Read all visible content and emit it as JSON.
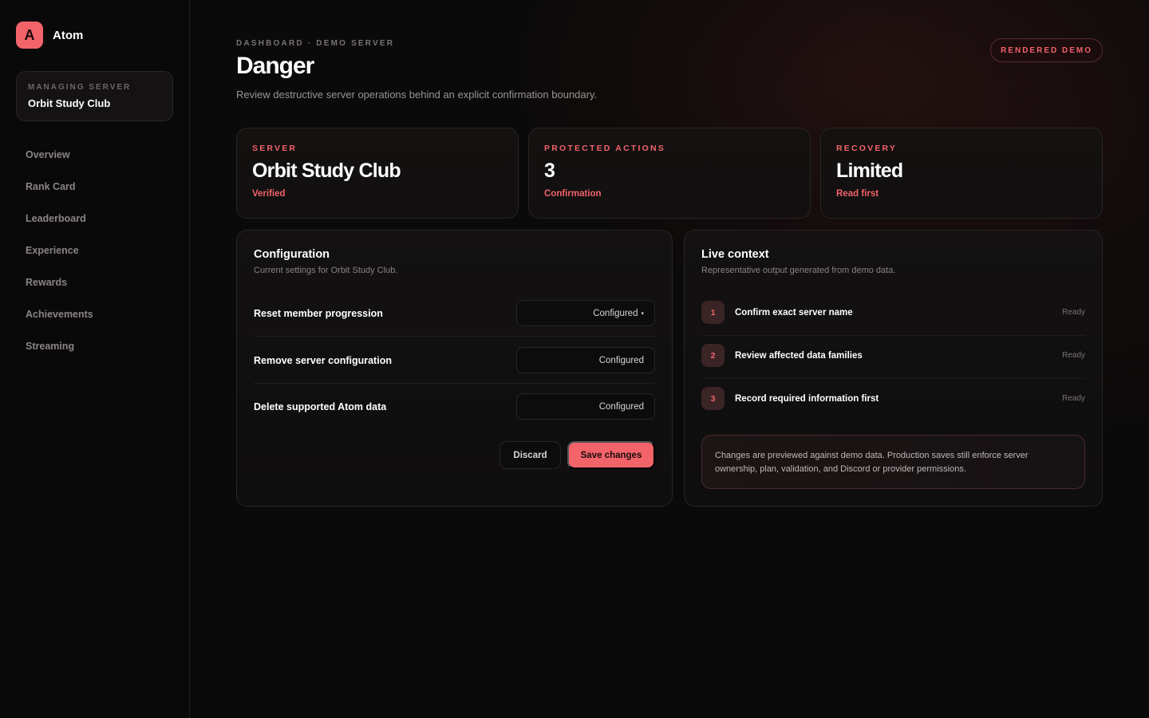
{
  "brand": {
    "logo_letter": "A",
    "name": "Atom"
  },
  "server_card": {
    "label": "MANAGING SERVER",
    "name": "Orbit Study Club"
  },
  "nav": {
    "items": [
      {
        "label": "Overview"
      },
      {
        "label": "Rank Card"
      },
      {
        "label": "Leaderboard"
      },
      {
        "label": "Experience"
      },
      {
        "label": "Rewards"
      },
      {
        "label": "Achievements"
      },
      {
        "label": "Streaming"
      }
    ]
  },
  "header": {
    "breadcrumb": "DASHBOARD · DEMO SERVER",
    "title": "Danger",
    "subtitle": "Review destructive server operations behind an explicit confirmation boundary.",
    "badge": "RENDERED DEMO"
  },
  "stats": [
    {
      "label": "SERVER",
      "value": "Orbit Study Club",
      "sub": "Verified"
    },
    {
      "label": "PROTECTED ACTIONS",
      "value": "3",
      "sub": "Confirmation"
    },
    {
      "label": "RECOVERY",
      "value": "Limited",
      "sub": "Read first"
    }
  ],
  "configuration": {
    "title": "Configuration",
    "subtitle": "Current settings for Orbit Study Club.",
    "rows": [
      {
        "label": "Reset member progression",
        "value": "Configured",
        "has_caret": true
      },
      {
        "label": "Remove server configuration",
        "value": "Configured"
      },
      {
        "label": "Delete supported Atom data",
        "value": "Configured"
      }
    ],
    "caret": "▾",
    "discard_label": "Discard",
    "save_label": "Save changes"
  },
  "live_context": {
    "title": "Live context",
    "subtitle": "Representative output generated from demo data.",
    "items": [
      {
        "num": "1",
        "text": "Confirm exact server name",
        "status": "Ready"
      },
      {
        "num": "2",
        "text": "Review affected data families",
        "status": "Ready"
      },
      {
        "num": "3",
        "text": "Record required information first",
        "status": "Ready"
      }
    ],
    "note": "Changes are previewed against demo data. Production saves still enforce server ownership, plan, validation, and Discord or provider permissions."
  },
  "colors": {
    "accent": "#f2636a",
    "background": "#0b0a0a"
  }
}
